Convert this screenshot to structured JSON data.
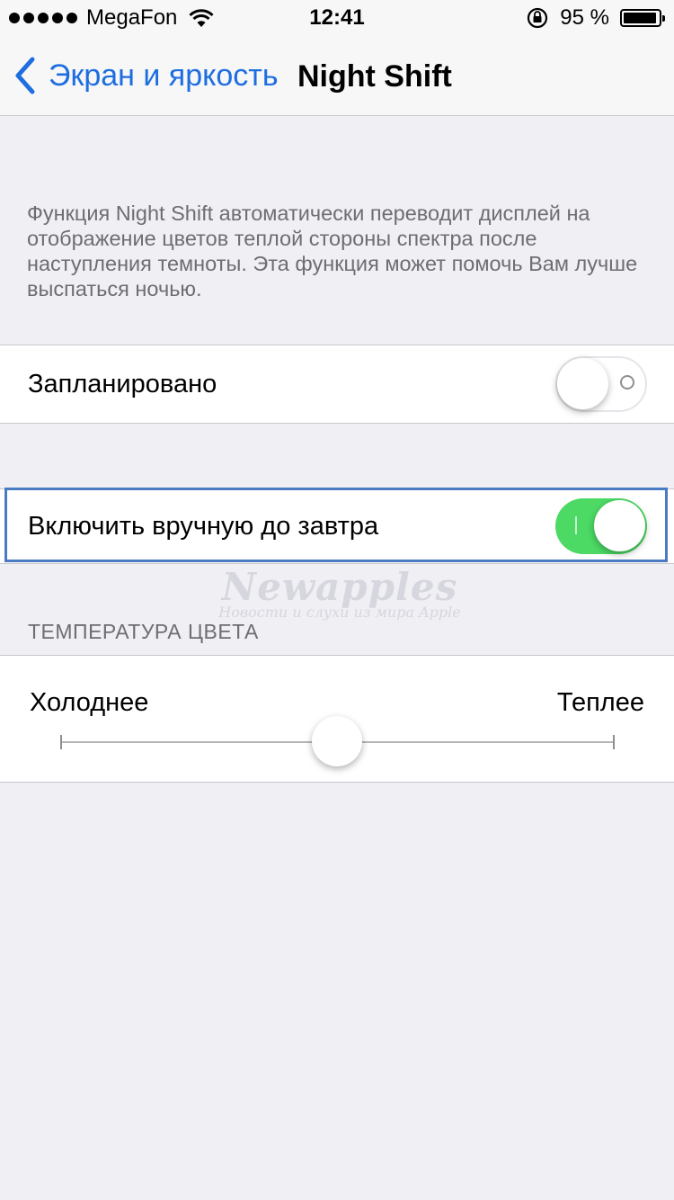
{
  "status_bar": {
    "carrier": "MegaFon",
    "time": "12:41",
    "battery": "95 %",
    "battery_level_percent": 95,
    "icons": [
      "signal-dots-icon",
      "wifi-icon",
      "rotation-lock-icon",
      "battery-icon"
    ]
  },
  "nav": {
    "back_label": "Экран и яркость",
    "title": "Night Shift"
  },
  "description": "Функция Night Shift автоматически переводит дисплей на отображение цветов теплой стороны спектра после наступления темноты. Эта функция может помочь Вам лучше выспаться ночью.",
  "settings": {
    "scheduled": {
      "label": "Запланировано",
      "enabled": false
    },
    "manual": {
      "label": "Включить вручную до завтра",
      "enabled": true
    }
  },
  "watermark": {
    "title": "Newapples",
    "subtitle": "Новости и слухи из мира Apple"
  },
  "temperature": {
    "header": "ТЕМПЕРАТУРА ЦВЕТА",
    "cooler_label": "Холоднее",
    "warmer_label": "Теплее",
    "value_fraction": 0.5
  },
  "colors": {
    "accent": "#1e6ee0",
    "switch_on": "#4cd964",
    "highlight": "#4a7bc2",
    "background": "#efeff4"
  }
}
